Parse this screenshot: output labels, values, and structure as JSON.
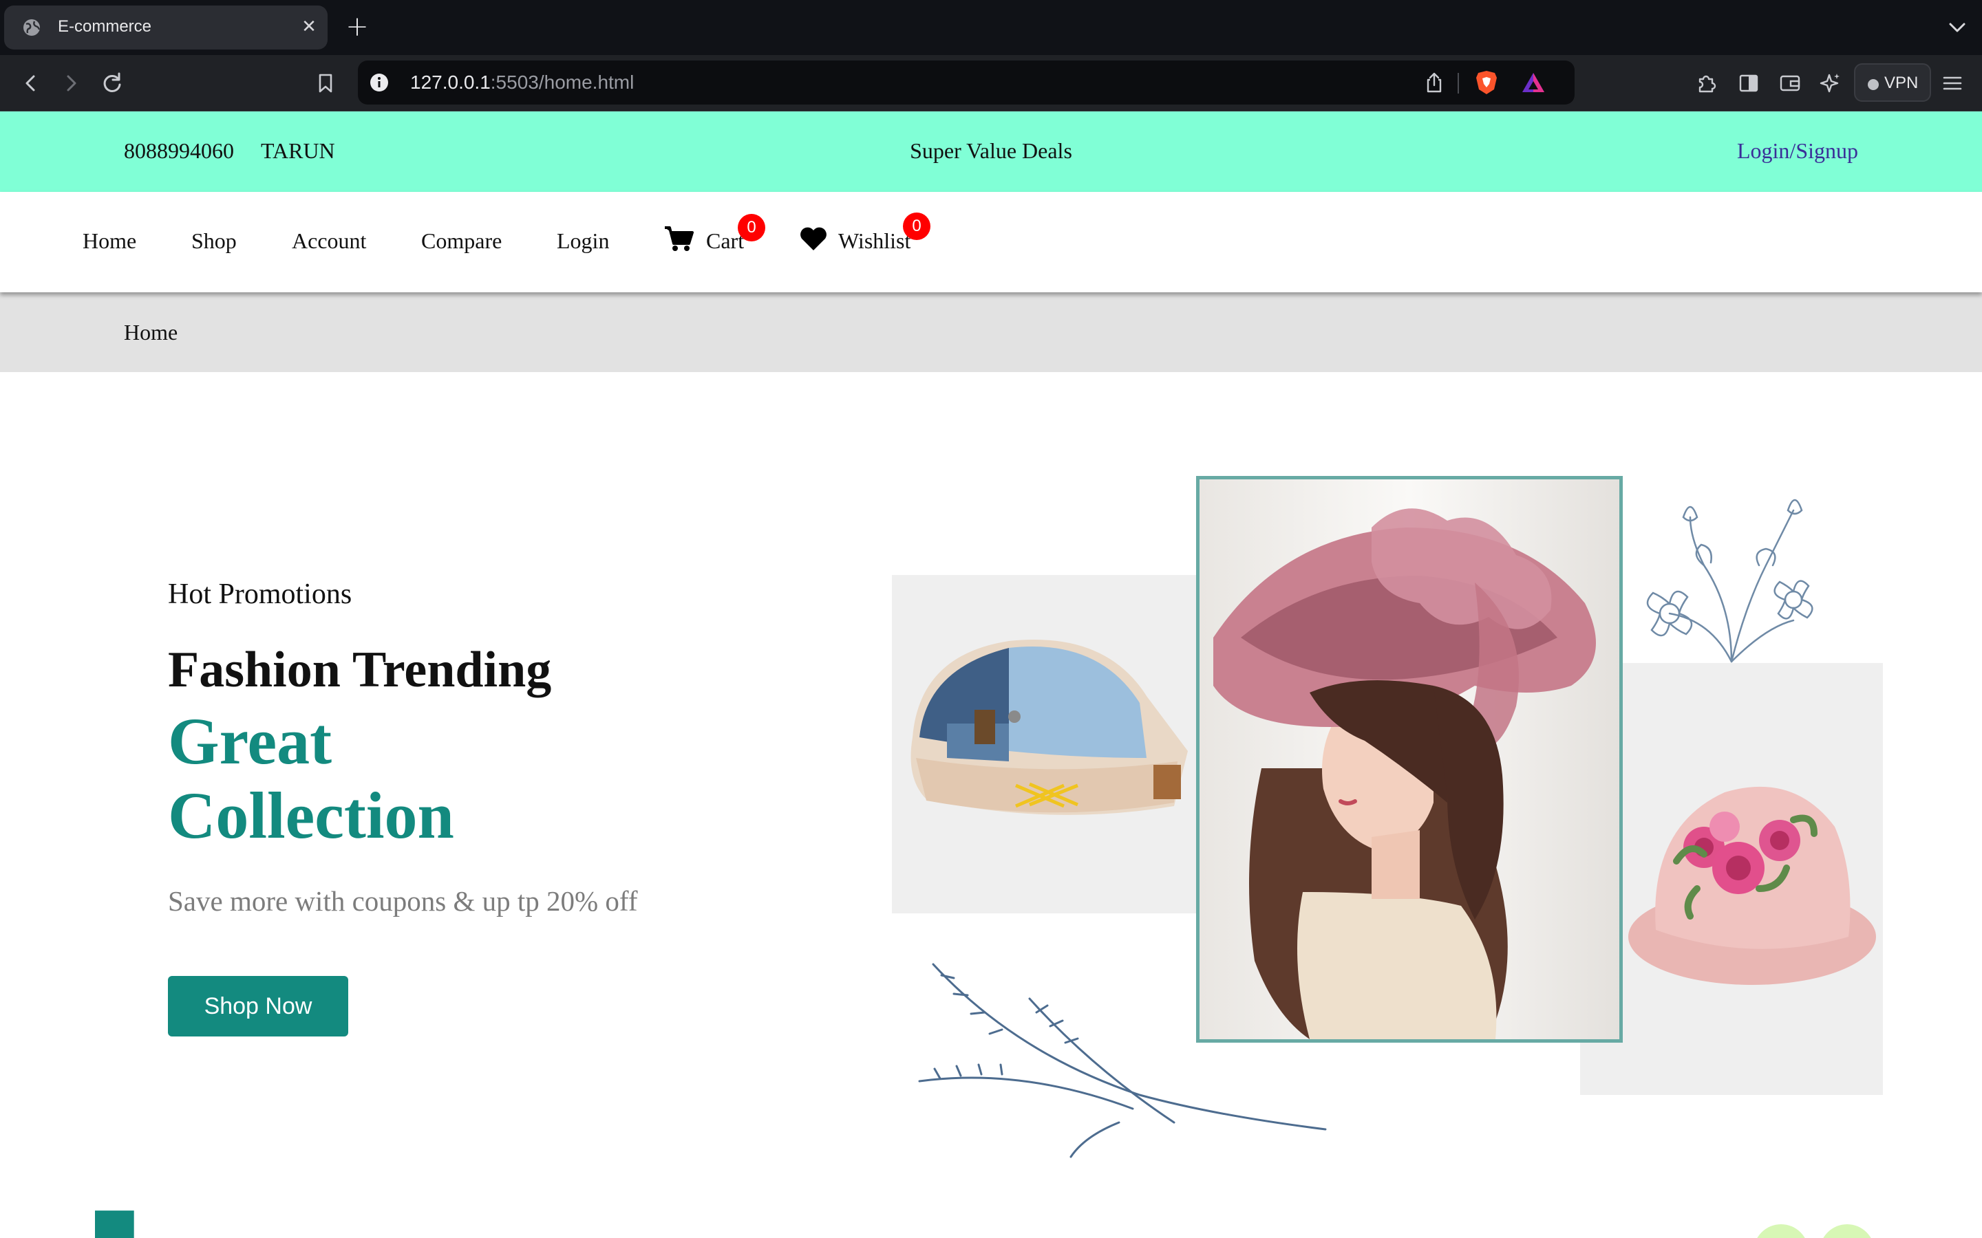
{
  "browser": {
    "tab_title": "E-commerce",
    "url_host": "127.0.0.1",
    "url_rest": ":5503/home.html",
    "vpn_label": "VPN"
  },
  "topbar": {
    "phone": "8088994060",
    "name": "TARUN",
    "deals": "Super Value Deals",
    "login_signup": "Login/Signup",
    "background": "#80ffd6"
  },
  "nav": {
    "home": "Home",
    "shop": "Shop",
    "account": "Account",
    "compare": "Compare",
    "login": "Login",
    "cart": "Cart",
    "cart_count": "0",
    "wishlist": "Wishlist",
    "wishlist_count": "0"
  },
  "breadcrumb": {
    "current": "Home"
  },
  "hero": {
    "subtitle": "Hot Promotions",
    "title": "Fashion Trending",
    "accent_line1": "Great",
    "accent_line2": "Collection",
    "description": "Save more with coupons & up tp 20% off",
    "button": "Shop Now",
    "accent_color": "#138a7f"
  },
  "icons": {
    "tab": [
      "globe-icon",
      "close-icon",
      "plus-icon",
      "chevron-down-icon"
    ],
    "toolbar": [
      "back-icon",
      "forward-icon",
      "reload-icon",
      "bookmark-icon",
      "info-icon",
      "share-icon",
      "brave-shield-icon",
      "brave-rewards-icon",
      "extensions-icon",
      "sidebar-icon",
      "wallet-icon",
      "leo-icon",
      "menu-icon"
    ],
    "nav": [
      "cart-icon",
      "heart-icon"
    ]
  }
}
